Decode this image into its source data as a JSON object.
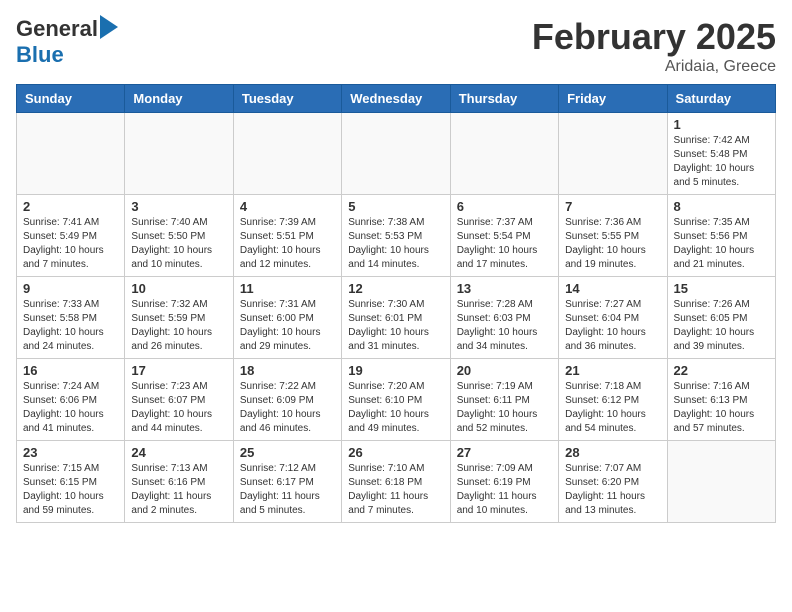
{
  "logo": {
    "general": "General",
    "blue": "Blue"
  },
  "title": "February 2025",
  "location": "Aridaia, Greece",
  "days_of_week": [
    "Sunday",
    "Monday",
    "Tuesday",
    "Wednesday",
    "Thursday",
    "Friday",
    "Saturday"
  ],
  "weeks": [
    [
      {
        "day": "",
        "info": ""
      },
      {
        "day": "",
        "info": ""
      },
      {
        "day": "",
        "info": ""
      },
      {
        "day": "",
        "info": ""
      },
      {
        "day": "",
        "info": ""
      },
      {
        "day": "",
        "info": ""
      },
      {
        "day": "1",
        "info": "Sunrise: 7:42 AM\nSunset: 5:48 PM\nDaylight: 10 hours\nand 5 minutes."
      }
    ],
    [
      {
        "day": "2",
        "info": "Sunrise: 7:41 AM\nSunset: 5:49 PM\nDaylight: 10 hours\nand 7 minutes."
      },
      {
        "day": "3",
        "info": "Sunrise: 7:40 AM\nSunset: 5:50 PM\nDaylight: 10 hours\nand 10 minutes."
      },
      {
        "day": "4",
        "info": "Sunrise: 7:39 AM\nSunset: 5:51 PM\nDaylight: 10 hours\nand 12 minutes."
      },
      {
        "day": "5",
        "info": "Sunrise: 7:38 AM\nSunset: 5:53 PM\nDaylight: 10 hours\nand 14 minutes."
      },
      {
        "day": "6",
        "info": "Sunrise: 7:37 AM\nSunset: 5:54 PM\nDaylight: 10 hours\nand 17 minutes."
      },
      {
        "day": "7",
        "info": "Sunrise: 7:36 AM\nSunset: 5:55 PM\nDaylight: 10 hours\nand 19 minutes."
      },
      {
        "day": "8",
        "info": "Sunrise: 7:35 AM\nSunset: 5:56 PM\nDaylight: 10 hours\nand 21 minutes."
      }
    ],
    [
      {
        "day": "9",
        "info": "Sunrise: 7:33 AM\nSunset: 5:58 PM\nDaylight: 10 hours\nand 24 minutes."
      },
      {
        "day": "10",
        "info": "Sunrise: 7:32 AM\nSunset: 5:59 PM\nDaylight: 10 hours\nand 26 minutes."
      },
      {
        "day": "11",
        "info": "Sunrise: 7:31 AM\nSunset: 6:00 PM\nDaylight: 10 hours\nand 29 minutes."
      },
      {
        "day": "12",
        "info": "Sunrise: 7:30 AM\nSunset: 6:01 PM\nDaylight: 10 hours\nand 31 minutes."
      },
      {
        "day": "13",
        "info": "Sunrise: 7:28 AM\nSunset: 6:03 PM\nDaylight: 10 hours\nand 34 minutes."
      },
      {
        "day": "14",
        "info": "Sunrise: 7:27 AM\nSunset: 6:04 PM\nDaylight: 10 hours\nand 36 minutes."
      },
      {
        "day": "15",
        "info": "Sunrise: 7:26 AM\nSunset: 6:05 PM\nDaylight: 10 hours\nand 39 minutes."
      }
    ],
    [
      {
        "day": "16",
        "info": "Sunrise: 7:24 AM\nSunset: 6:06 PM\nDaylight: 10 hours\nand 41 minutes."
      },
      {
        "day": "17",
        "info": "Sunrise: 7:23 AM\nSunset: 6:07 PM\nDaylight: 10 hours\nand 44 minutes."
      },
      {
        "day": "18",
        "info": "Sunrise: 7:22 AM\nSunset: 6:09 PM\nDaylight: 10 hours\nand 46 minutes."
      },
      {
        "day": "19",
        "info": "Sunrise: 7:20 AM\nSunset: 6:10 PM\nDaylight: 10 hours\nand 49 minutes."
      },
      {
        "day": "20",
        "info": "Sunrise: 7:19 AM\nSunset: 6:11 PM\nDaylight: 10 hours\nand 52 minutes."
      },
      {
        "day": "21",
        "info": "Sunrise: 7:18 AM\nSunset: 6:12 PM\nDaylight: 10 hours\nand 54 minutes."
      },
      {
        "day": "22",
        "info": "Sunrise: 7:16 AM\nSunset: 6:13 PM\nDaylight: 10 hours\nand 57 minutes."
      }
    ],
    [
      {
        "day": "23",
        "info": "Sunrise: 7:15 AM\nSunset: 6:15 PM\nDaylight: 10 hours\nand 59 minutes."
      },
      {
        "day": "24",
        "info": "Sunrise: 7:13 AM\nSunset: 6:16 PM\nDaylight: 11 hours\nand 2 minutes."
      },
      {
        "day": "25",
        "info": "Sunrise: 7:12 AM\nSunset: 6:17 PM\nDaylight: 11 hours\nand 5 minutes."
      },
      {
        "day": "26",
        "info": "Sunrise: 7:10 AM\nSunset: 6:18 PM\nDaylight: 11 hours\nand 7 minutes."
      },
      {
        "day": "27",
        "info": "Sunrise: 7:09 AM\nSunset: 6:19 PM\nDaylight: 11 hours\nand 10 minutes."
      },
      {
        "day": "28",
        "info": "Sunrise: 7:07 AM\nSunset: 6:20 PM\nDaylight: 11 hours\nand 13 minutes."
      },
      {
        "day": "",
        "info": ""
      }
    ]
  ]
}
